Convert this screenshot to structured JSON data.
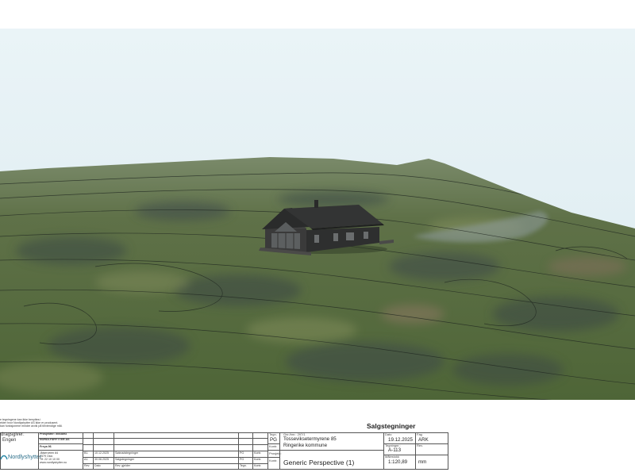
{
  "disclaimer": [
    "e tegningene kan ikke benyttes i",
    "ekter hvor Nordlyshytter AS ikke er produsent.",
    "kan funksjonene mindre avvik på tilrvtendige mål."
  ],
  "client": {
    "label": "dragsgiver:",
    "name": "Engen"
  },
  "project": {
    "number_label": "Prosjektnr: 5003893",
    "company_line": "NORDLYSHYTTER AS",
    "model": "Freya 96",
    "address": [
      "Jålserveien 84",
      "2379 Oslo"
    ],
    "phone": "Tlf: 22 10 10 00",
    "web": "www.nordlyshytter.no"
  },
  "company_logo_text": "Nordlyshytter",
  "revisions": [
    {
      "rev": "B1.",
      "date": "10.12.2025",
      "text": "Søknadstegninger",
      "by": "PG",
      "check": "Kontr."
    },
    {
      "rev": "A1.",
      "date": "30.06.2025",
      "text": "Salgstegninger",
      "by": "PG",
      "check": "Kontr."
    }
  ],
  "rev_headers": {
    "rev": "Rev.",
    "date": "Dato",
    "text": "Rev. gjelder",
    "by": "Tegn.",
    "check": "Kontr."
  },
  "sheet_title": "Salgstegninger",
  "drawn": {
    "label": "Tegn.",
    "value": "PG",
    "kontr": "Kontr."
  },
  "property": {
    "label": "Gnr./bnr.: 297/1",
    "address": "Tosseviksetermyrene 85",
    "municipality": "Ringerike kommune",
    "project_label": "Prosjekt:"
  },
  "view_name": "Generic Perspective (1)",
  "meta": {
    "date_label": "Dato",
    "date_value": "19.12.2025",
    "discipline_label": "Fag",
    "discipline_value": "ARK",
    "drawing_no_label": "Tegningnr.:",
    "drawing_no_value": "A-113",
    "rev_label": "Rev.",
    "scale_label": "Målestokk",
    "scale_value": "1:120,89",
    "unit": "mm"
  },
  "colors": {
    "sky": "#e6f1f5",
    "terrain": "#5d6f45",
    "house": "#2f3030"
  }
}
